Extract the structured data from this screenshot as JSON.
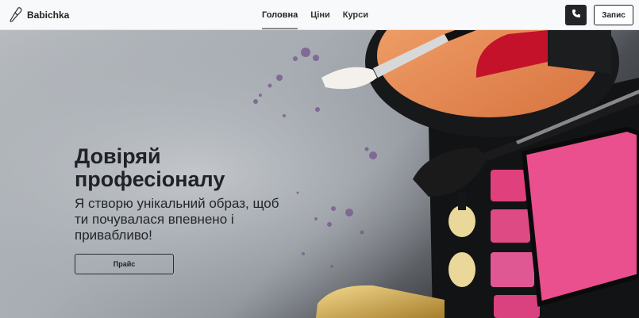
{
  "navbar": {
    "brand": {
      "label": "Babichka",
      "icon": "makeup-brush-icon"
    },
    "links": [
      {
        "label": "Головна",
        "active": true
      },
      {
        "label": "Ціни",
        "active": false
      },
      {
        "label": "Курси",
        "active": false
      }
    ],
    "phone_icon": "phone-icon",
    "book_label": "Запис"
  },
  "hero": {
    "title": "Довіряй професіоналу",
    "subtitle": "Я створю унікальний образ, щоб ти почувалася впевнено і привабливо!",
    "button_label": "Прайс"
  },
  "colors": {
    "navbar_bg": "#f8f9fa",
    "dark_button": "#212529",
    "lipstick": "#c4122a",
    "blush": "#e24a86"
  }
}
